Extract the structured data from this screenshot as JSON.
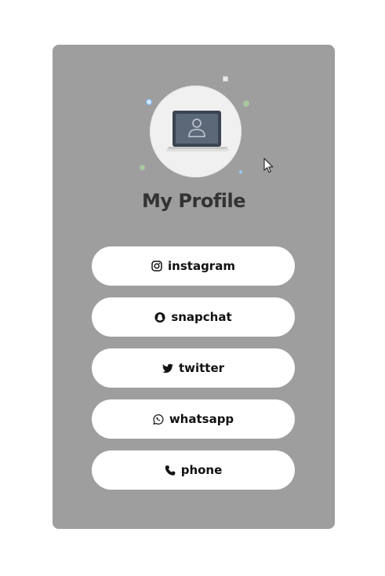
{
  "profile": {
    "title": "My Profile",
    "avatar_icon": "laptop-user-icon"
  },
  "links": [
    {
      "label": "instagram",
      "icon": "instagram-icon"
    },
    {
      "label": "snapchat",
      "icon": "snapchat-icon"
    },
    {
      "label": "twitter",
      "icon": "twitter-icon"
    },
    {
      "label": "whatsapp",
      "icon": "whatsapp-icon"
    },
    {
      "label": "phone",
      "icon": "phone-icon"
    }
  ],
  "colors": {
    "card_background": "#9e9e9e",
    "button_background": "#ffffff",
    "title_text": "#333333",
    "button_text": "#111111"
  }
}
